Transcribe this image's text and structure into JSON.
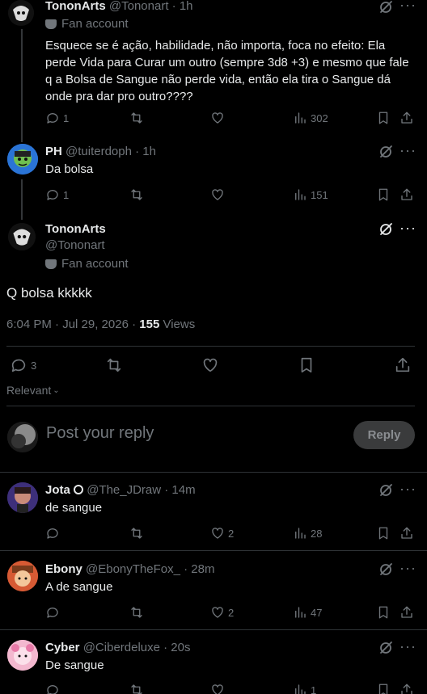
{
  "tweets_above": [
    {
      "name": "TononArts",
      "handle": "@Tononart · 1h",
      "fan_label": "Fan account",
      "text": "Esquece se é ação, habilidade, não importa, foca no efeito: Ela perde Vida para Curar um outro (sempre 3d8 +3) e mesmo que fale q a Bolsa de Sangue não perde vida, então ela tira o Sangue dá onde pra dar pro outro????",
      "replies": "1",
      "views": "302"
    },
    {
      "name": "PH",
      "handle": "@tuiterdoph · 1h",
      "text": "Da bolsa",
      "replies": "1",
      "views": "151"
    }
  ],
  "main_tweet": {
    "name": "TononArts",
    "handle": "@Tononart",
    "fan_label": "Fan account",
    "text": "Q bolsa kkkkk",
    "time": "6:04 PM · Jul 29, 2026 · ",
    "views_count": "155",
    "views_label": " Views",
    "replies": "3"
  },
  "sort_label": "Relevant",
  "composer": {
    "placeholder": "Post your reply",
    "reply_button": "Reply"
  },
  "replies": [
    {
      "name": "Jota",
      "handle": "@The_JDraw · 14m",
      "text": "de sangue",
      "likes": "2",
      "views": "28"
    },
    {
      "name": "Ebony",
      "handle": "@EbonyTheFox_ · 28m",
      "text": "A de sangue",
      "likes": "2",
      "views": "47"
    },
    {
      "name": "Cyber",
      "handle": "@Ciberdeluxe · 20s",
      "text": "De sangue",
      "likes": "",
      "views": "1"
    }
  ],
  "colors": {
    "background": "#000000",
    "text": "#e7e9ea",
    "muted": "#71767b",
    "divider": "#2f3336"
  }
}
